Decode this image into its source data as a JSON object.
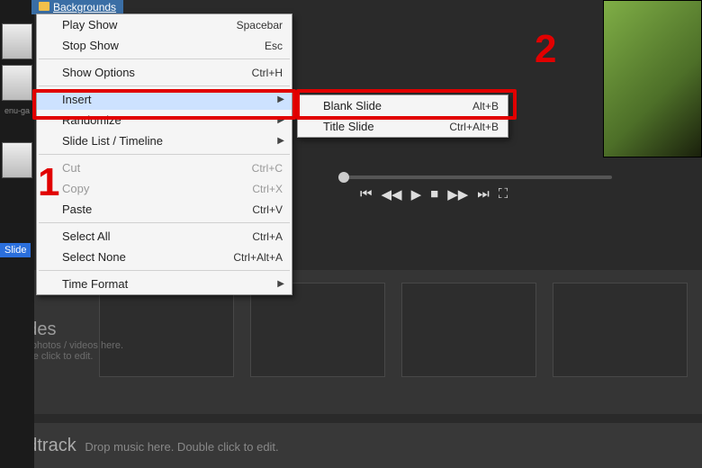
{
  "folder_tab": "Backgrounds",
  "left": {
    "enuga": "enu-ga"
  },
  "slide_badge": "Slide",
  "menu": {
    "play_show": {
      "label": "Play Show",
      "accel": "Spacebar"
    },
    "stop_show": {
      "label": "Stop Show",
      "accel": "Esc"
    },
    "show_options": {
      "label": "Show Options",
      "accel": "Ctrl+H"
    },
    "insert": {
      "label": "Insert"
    },
    "randomize": {
      "label": "Randomize"
    },
    "slide_list": {
      "label": "Slide List / Timeline"
    },
    "cut": {
      "label": "Cut",
      "accel": "Ctrl+C"
    },
    "copy": {
      "label": "Copy",
      "accel": "Ctrl+X"
    },
    "paste": {
      "label": "Paste",
      "accel": "Ctrl+V"
    },
    "select_all": {
      "label": "Select All",
      "accel": "Ctrl+A"
    },
    "select_none": {
      "label": "Select None",
      "accel": "Ctrl+Alt+A"
    },
    "time_format": {
      "label": "Time Format"
    }
  },
  "submenu": {
    "blank_slide": {
      "label": "Blank Slide",
      "accel": "Alt+B"
    },
    "title_slide": {
      "label": "Title Slide",
      "accel": "Ctrl+Alt+B"
    }
  },
  "slides_panel": {
    "title": "Slides",
    "hint1": "Drop photos / videos here.",
    "hint2": "Double click to edit."
  },
  "soundtrack": {
    "title": "undtrack",
    "hint": "Drop music here.  Double click to edit."
  },
  "annotations": {
    "one": "1",
    "two": "2"
  }
}
